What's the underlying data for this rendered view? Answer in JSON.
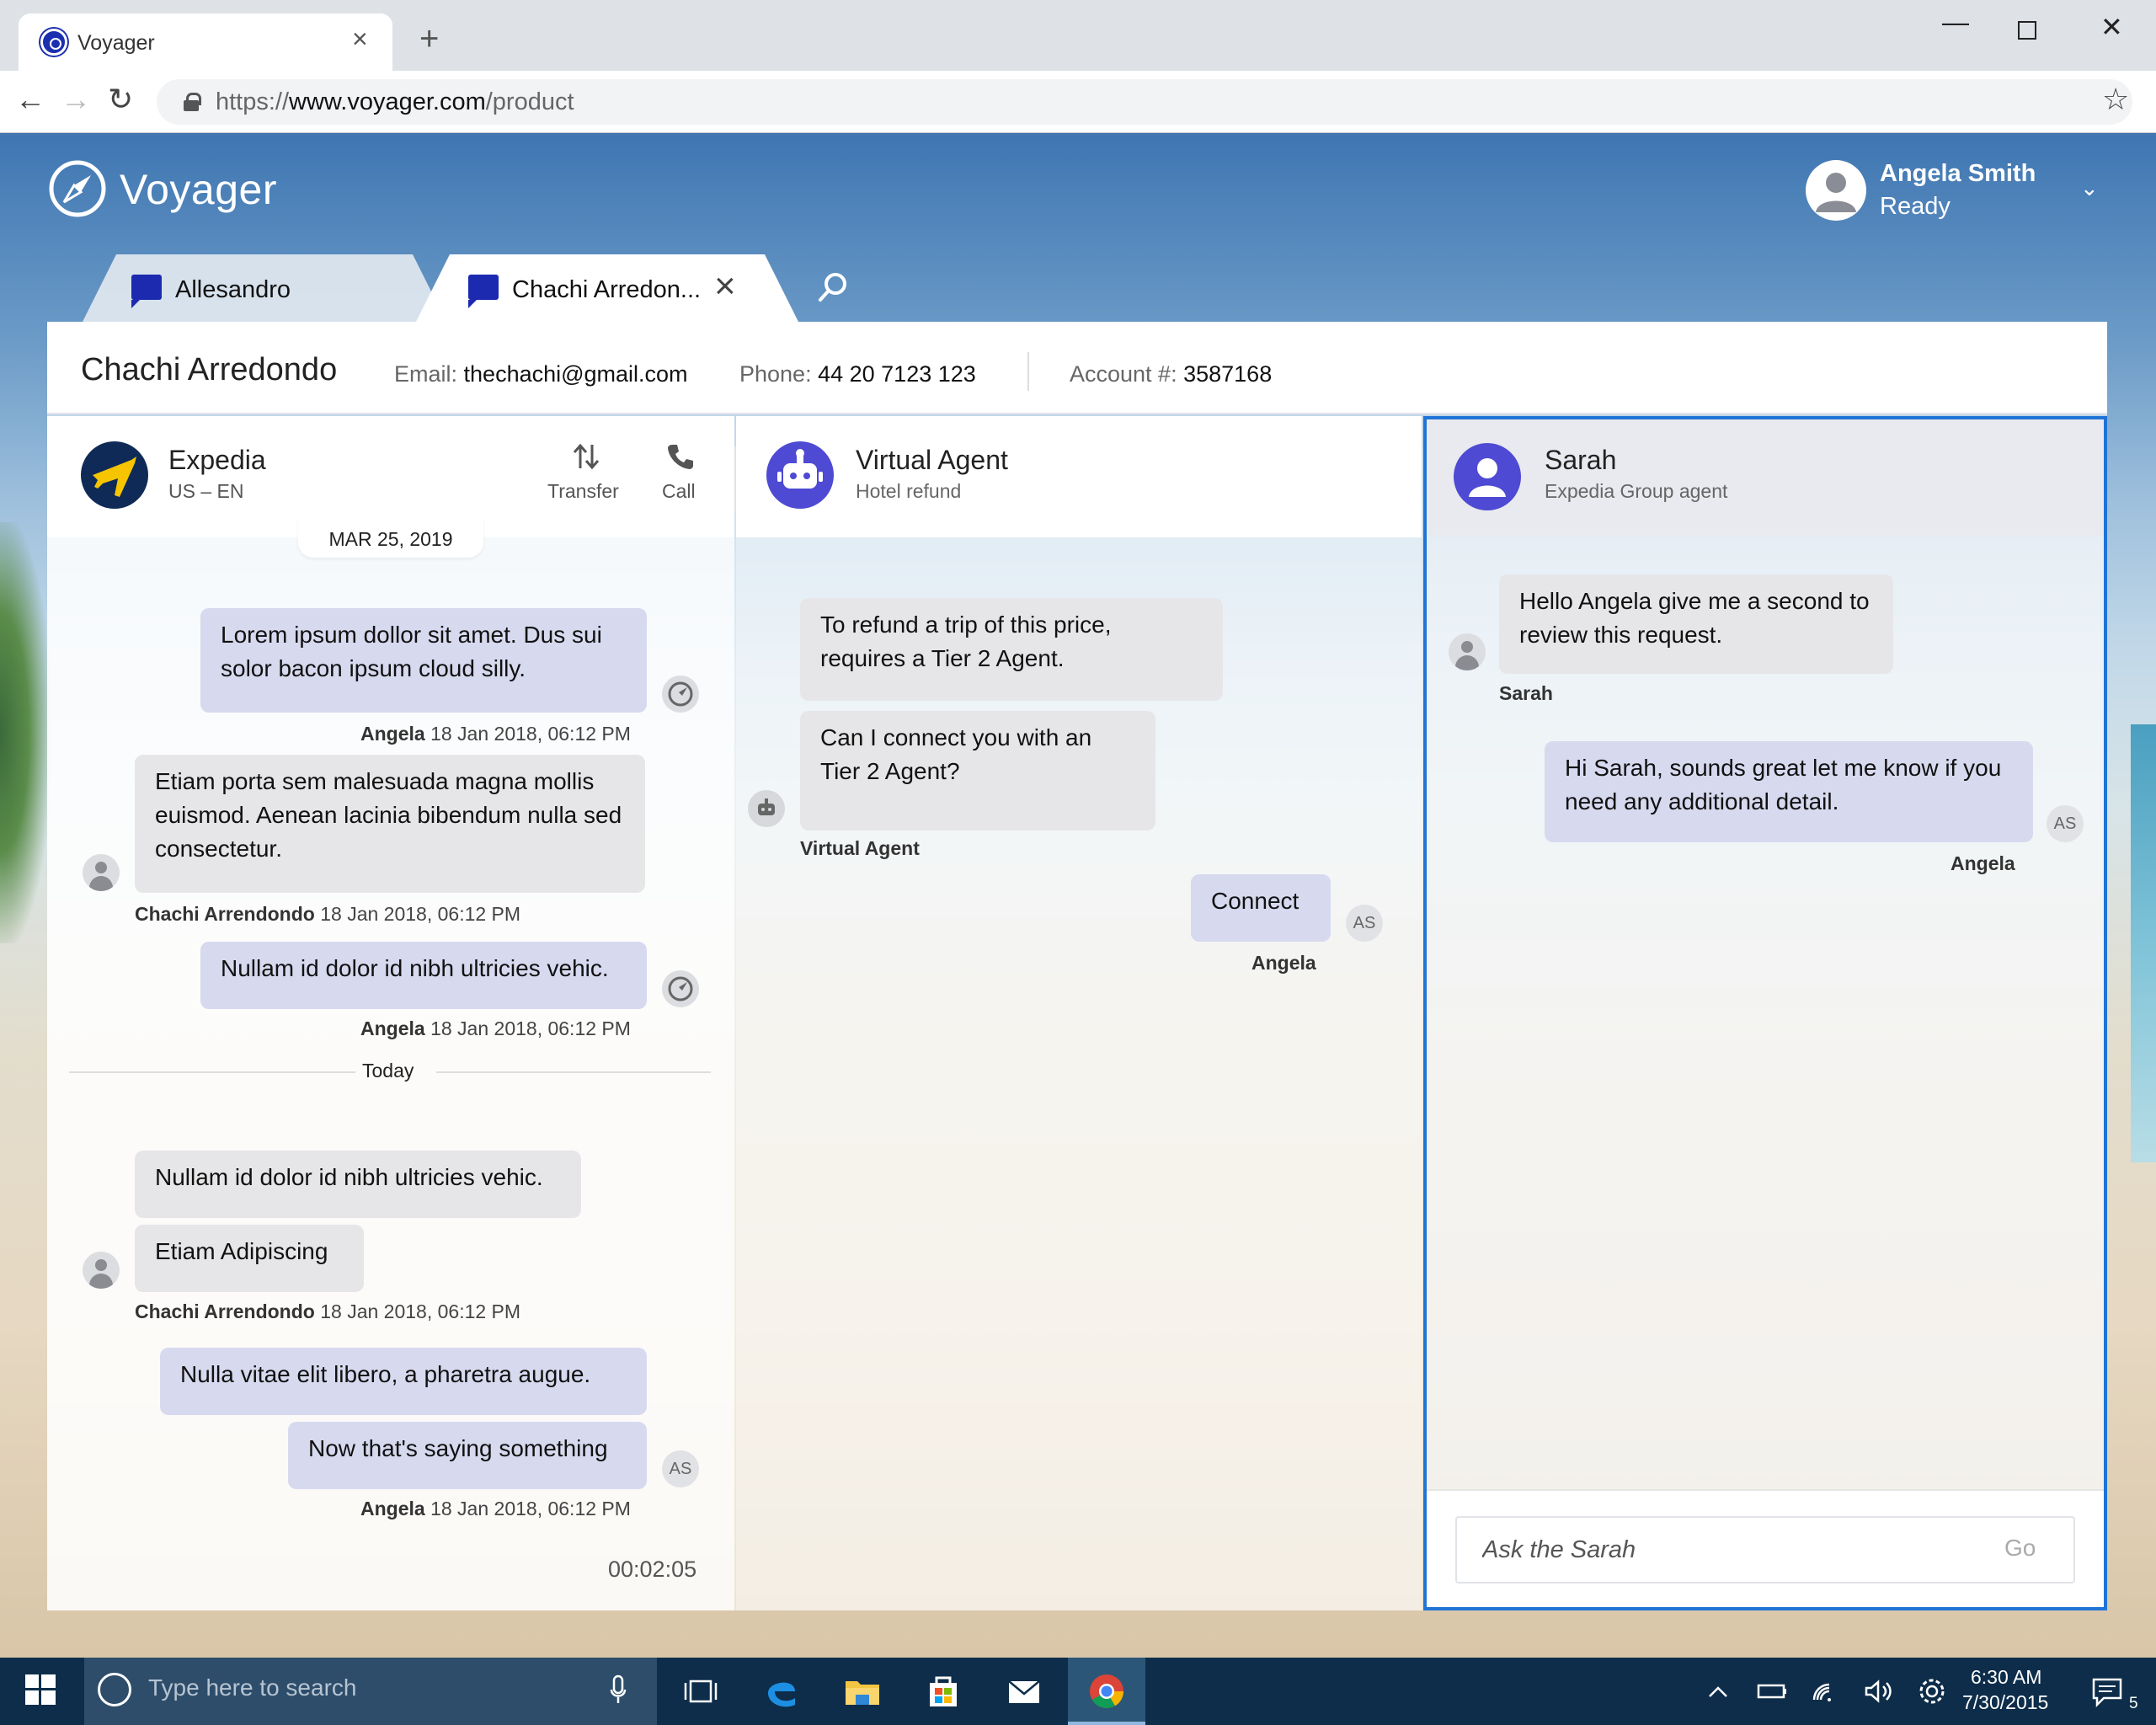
{
  "browser": {
    "tab_title": "Voyager",
    "url_prefix": "https://",
    "url_domain": "www.voyager.com",
    "url_path": "/product"
  },
  "app": {
    "name": "Voyager",
    "user": {
      "name": "Angela Smith",
      "status": "Ready"
    }
  },
  "conversation_tabs": [
    {
      "label": "Allesandro"
    },
    {
      "label": "Chachi Arredon..."
    }
  ],
  "contact": {
    "name": "Chachi Arredondo",
    "email_label": "Email:",
    "email": "thechachi@gmail.com",
    "phone_label": "Phone:",
    "phone": "44 20 7123 123",
    "account_label": "Account #:",
    "account": "3587168"
  },
  "customer_panel": {
    "org": "Expedia",
    "locale": "US – EN",
    "actions": [
      {
        "label": "Transfer"
      },
      {
        "label": "Call"
      }
    ],
    "date_pill": "MAR 25, 2019",
    "today_label": "Today",
    "timer": "00:02:05",
    "messages": [
      {
        "text": "Lorem ipsum dollor sit amet. Dus sui solor bacon ipsum cloud silly.",
        "author": "Angela",
        "time": "18 Jan 2018, 06:12 PM"
      },
      {
        "text": "Etiam porta sem malesuada magna mollis euismod. Aenean lacinia bibendum nulla sed consectetur.",
        "author": "Chachi Arrendondo",
        "time": "18 Jan 2018, 06:12 PM"
      },
      {
        "text": "Nullam id dolor id nibh ultricies vehic.",
        "author": "Angela",
        "time": "18 Jan 2018, 06:12 PM"
      },
      {
        "text": "Nullam id dolor id nibh ultricies vehic."
      },
      {
        "text": "Etiam Adipiscing",
        "author": "Chachi Arrendondo",
        "time": "18 Jan 2018, 06:12 PM"
      },
      {
        "text": "Nulla vitae elit libero, a pharetra augue."
      },
      {
        "text": "Now that's saying something",
        "author": "Angela",
        "time": "18 Jan 2018, 06:12 PM",
        "initials": "AS"
      }
    ]
  },
  "bot_panel": {
    "name": "Virtual Agent",
    "subtitle": "Hotel refund",
    "messages": [
      {
        "text": "To refund a trip of this price, requires a Tier 2 Agent."
      },
      {
        "text": "Can I connect you with an Tier 2 Agent?",
        "author": "Virtual Agent"
      },
      {
        "text": "Connect",
        "author": "Angela",
        "initials": "AS"
      }
    ]
  },
  "agent_panel": {
    "name": "Sarah",
    "subtitle": "Expedia Group agent",
    "messages": [
      {
        "text": "Hello Angela give me a second to review this request.",
        "author": "Sarah"
      },
      {
        "text": "Hi Sarah, sounds great let me know if you need any additional detail.",
        "author": "Angela",
        "initials": "AS"
      }
    ],
    "input_placeholder": "Ask the Sarah",
    "go_label": "Go"
  },
  "taskbar": {
    "search_placeholder": "Type here to search",
    "time": "6:30 AM",
    "date": "7/30/2015",
    "notifications": "5"
  },
  "colors": {
    "accent": "#1f74d6",
    "brand": "#1c2ab0",
    "bot": "#4e4ad3",
    "mine_bubble": "#d7d9ef",
    "their_bubble": "#e6e6e8"
  }
}
